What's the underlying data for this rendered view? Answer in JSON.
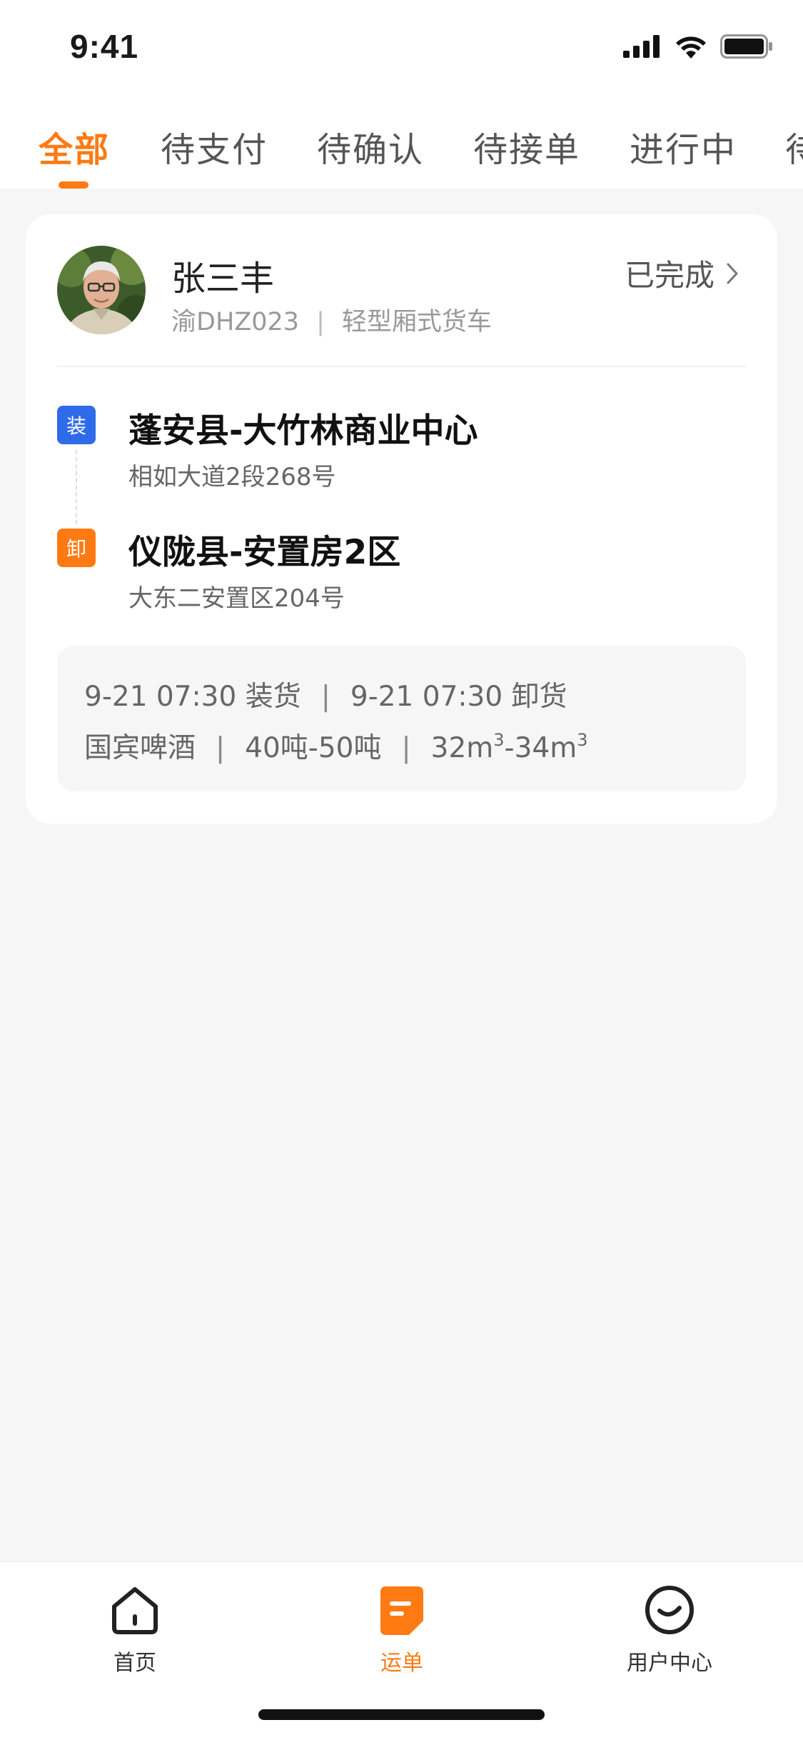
{
  "status_bar": {
    "time": "9:41"
  },
  "tabs": [
    {
      "label": "全部",
      "active": true
    },
    {
      "label": "待支付",
      "active": false
    },
    {
      "label": "待确认",
      "active": false
    },
    {
      "label": "待接单",
      "active": false
    },
    {
      "label": "进行中",
      "active": false
    },
    {
      "label": "待",
      "active": false
    }
  ],
  "order": {
    "driver_name": "张三丰",
    "plate": "渝DHZ023",
    "vehicle_type": "轻型厢式货车",
    "status": "已完成",
    "load": {
      "badge": "装",
      "title": "蓬安县-大竹林商业中心",
      "address": "相如大道2段268号"
    },
    "unload": {
      "badge": "卸",
      "title": "仪陇县-安置房2区",
      "address": "大东二安置区204号"
    },
    "info": {
      "load_time": "9-21 07:30 装货",
      "unload_time": "9-21 07:30 卸货",
      "goods": "国宾啤酒",
      "weight": "40吨-50吨",
      "volume_from": "32m",
      "volume_to": "-34m",
      "cube": "3"
    }
  },
  "bottom_nav": [
    {
      "label": "首页",
      "icon": "home-icon",
      "active": false
    },
    {
      "label": "运单",
      "icon": "waybill-icon",
      "active": true
    },
    {
      "label": "用户中心",
      "icon": "user-center-icon",
      "active": false
    }
  ],
  "colors": {
    "accent": "#ff7a12",
    "load_badge": "#2f6be8",
    "unload_badge": "#ff7a12"
  }
}
